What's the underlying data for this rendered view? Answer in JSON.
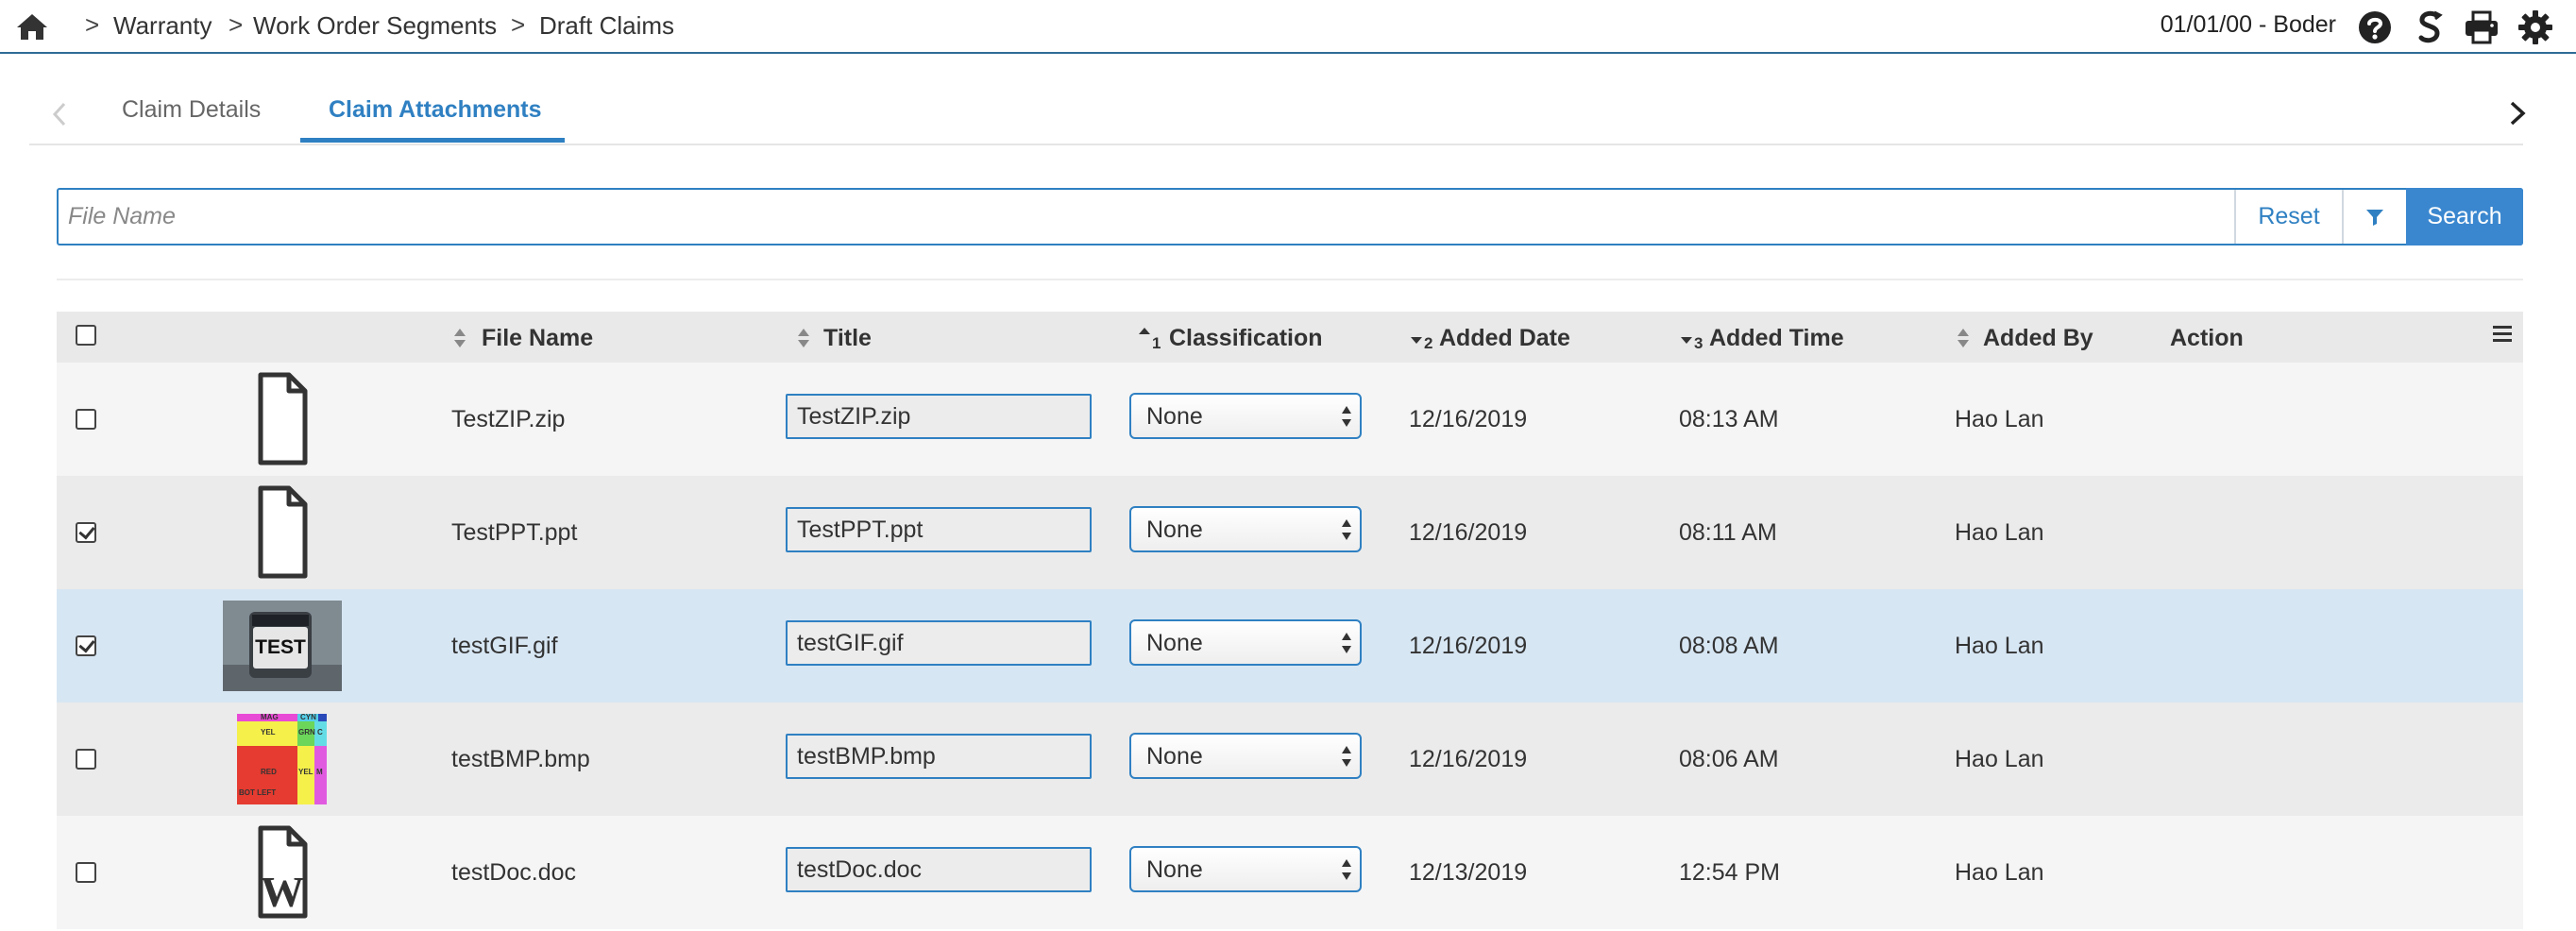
{
  "breadcrumb": {
    "items": [
      "Warranty",
      "Work Order Segments",
      "Draft Claims"
    ],
    "separator": ">"
  },
  "header": {
    "user_info": "01/01/00 - Boder"
  },
  "tabs": [
    {
      "label": "Claim Details",
      "active": false
    },
    {
      "label": "Claim Attachments",
      "active": true
    }
  ],
  "search": {
    "placeholder": "File Name",
    "value": "",
    "reset_label": "Reset",
    "search_label": "Search"
  },
  "table": {
    "columns": {
      "file_name": "File Name",
      "title": "Title",
      "classification": "Classification",
      "added_date": "Added Date",
      "added_time": "Added Time",
      "added_by": "Added By",
      "action": "Action"
    },
    "sort_orders": {
      "classification": "1",
      "added_date": "2",
      "added_time": "3"
    },
    "rows": [
      {
        "checked": false,
        "thumb": "file-icon",
        "file_name": "TestZIP.zip",
        "title": "TestZIP.zip",
        "classification": "None",
        "added_date": "12/16/2019",
        "added_time": "08:13 AM",
        "added_by": "Hao Lan"
      },
      {
        "checked": true,
        "thumb": "file-icon",
        "file_name": "TestPPT.ppt",
        "title": "TestPPT.ppt",
        "classification": "None",
        "added_date": "12/16/2019",
        "added_time": "08:11 AM",
        "added_by": "Hao Lan"
      },
      {
        "checked": true,
        "thumb": "test-image",
        "thumb_text": "TEST",
        "file_name": "testGIF.gif",
        "title": "testGIF.gif",
        "classification": "None",
        "added_date": "12/16/2019",
        "added_time": "08:08 AM",
        "added_by": "Hao Lan"
      },
      {
        "checked": false,
        "thumb": "color-bars-image",
        "thumb_labels": [
          "MAG",
          "CYN",
          "YEL",
          "GRN",
          "C",
          "RED",
          "YEL",
          "M",
          "BOT LEFT"
        ],
        "file_name": "testBMP.bmp",
        "title": "testBMP.bmp",
        "classification": "None",
        "added_date": "12/16/2019",
        "added_time": "08:06 AM",
        "added_by": "Hao Lan"
      },
      {
        "checked": false,
        "thumb": "word-doc-icon",
        "thumb_text": "W",
        "file_name": "testDoc.doc",
        "title": "testDoc.doc",
        "classification": "None",
        "added_date": "12/13/2019",
        "added_time": "12:54 PM",
        "added_by": "Hao Lan"
      }
    ]
  },
  "colors": {
    "accent": "#2f80c2",
    "header_border": "#2f6c96",
    "search_button": "#3a87cf",
    "row_highlight": "#d7e6f3"
  }
}
